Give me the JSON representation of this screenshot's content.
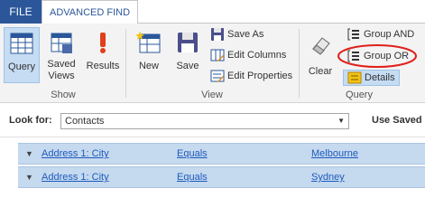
{
  "tabs": {
    "file": "FILE",
    "advanced_find": "ADVANCED FIND"
  },
  "ribbon": {
    "show": {
      "query": "Query",
      "saved_views_1": "Saved",
      "saved_views_2": "Views",
      "results": "Results",
      "group_label": "Show"
    },
    "view": {
      "new": "New",
      "save": "Save",
      "save_as": "Save As",
      "edit_columns": "Edit Columns",
      "edit_properties": "Edit Properties",
      "group_label": "View"
    },
    "query": {
      "clear": "Clear",
      "group_and": "Group AND",
      "group_or": "Group OR",
      "details": "Details",
      "group_label": "Query"
    }
  },
  "look_for": {
    "label": "Look for:",
    "value": "Contacts",
    "use_saved_view": "Use Saved V"
  },
  "conditions": [
    {
      "field": "Address 1: City",
      "operator": "Equals",
      "value": "Melbourne"
    },
    {
      "field": "Address 1: City",
      "operator": "Equals",
      "value": "Sydney"
    }
  ],
  "colors": {
    "accent": "#2b579a",
    "selected": "#c5dcf2",
    "highlight_ring": "#e0201b",
    "link": "#1e5bbd"
  }
}
